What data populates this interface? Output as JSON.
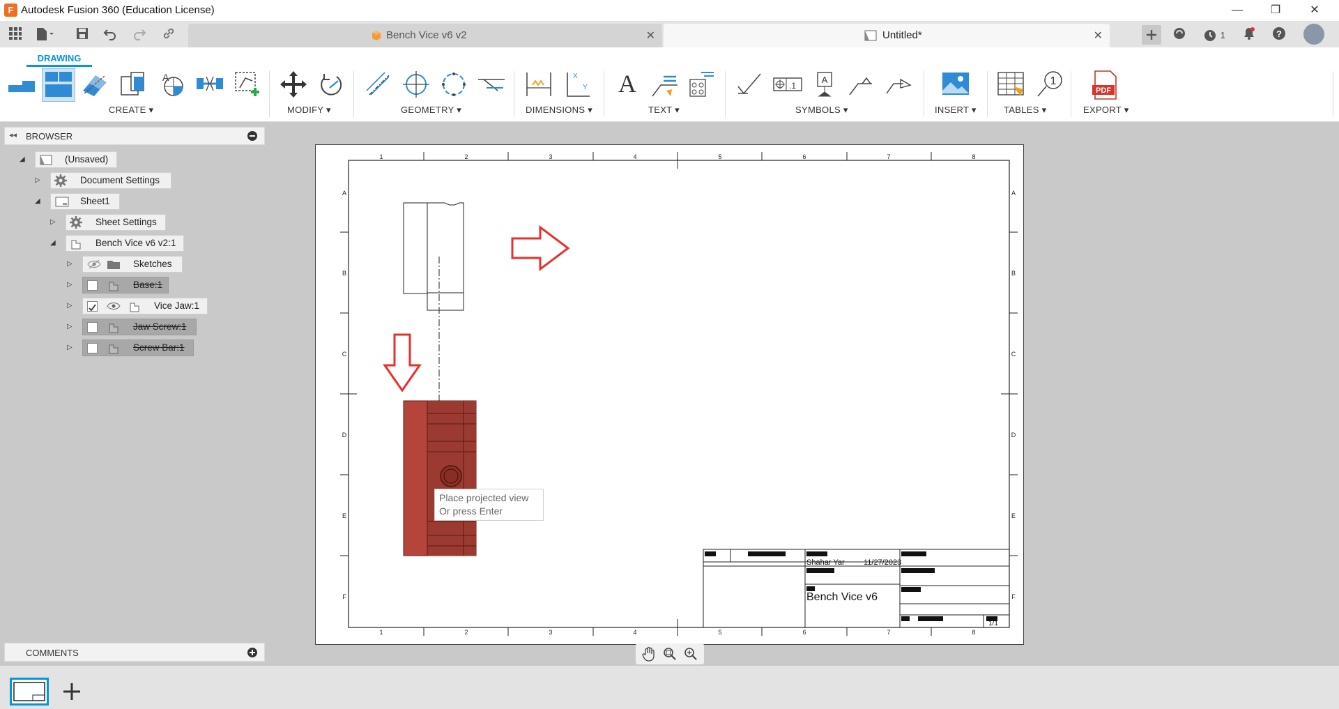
{
  "app": {
    "title": "Autodesk Fusion 360 (Education License)",
    "logo_letter": "F"
  },
  "window_controls": {
    "minimize": "—",
    "restore": "❐",
    "close": "✕"
  },
  "tabs": [
    {
      "label": "Bench Vice v6 v2",
      "active": false
    },
    {
      "label": "Untitled*",
      "active": true
    }
  ],
  "tabbar_right": {
    "jobs_count": "1"
  },
  "toolbar": {
    "workspace_tab": "DRAWING",
    "groups": [
      {
        "label": "CREATE ▾"
      },
      {
        "label": "MODIFY ▾"
      },
      {
        "label": "GEOMETRY ▾"
      },
      {
        "label": "DIMENSIONS ▾"
      },
      {
        "label": "TEXT ▾"
      },
      {
        "label": "SYMBOLS ▾"
      },
      {
        "label": "INSERT ▾"
      },
      {
        "label": "TABLES ▾"
      },
      {
        "label": "EXPORT ▾"
      }
    ],
    "text_tool_glyph": "A",
    "pdf_label": "PDF",
    "balloon_number": "1"
  },
  "browser": {
    "title": "BROWSER",
    "items": [
      {
        "label": "(Unsaved)"
      },
      {
        "label": "Document Settings"
      },
      {
        "label": "Sheet1"
      },
      {
        "label": "Sheet Settings"
      },
      {
        "label": "Bench Vice v6 v2:1"
      },
      {
        "label": "Sketches"
      },
      {
        "label": "Base:1",
        "visible": false
      },
      {
        "label": "Vice Jaw:1",
        "visible": true
      },
      {
        "label": "Jaw Screw:1",
        "visible": false
      },
      {
        "label": "Screw Bar:1",
        "visible": false
      }
    ]
  },
  "comments": {
    "title": "COMMENTS"
  },
  "sheet": {
    "col_labels": [
      "1",
      "2",
      "3",
      "4",
      "5",
      "6",
      "7",
      "8"
    ],
    "row_labels": [
      "A",
      "B",
      "C",
      "D",
      "E",
      "F"
    ],
    "title_block": {
      "author": "Shahar Yar",
      "date": "11/27/2023",
      "title": "Bench Vice v6",
      "sheet": "1/1"
    }
  },
  "tooltip": {
    "line1": "Place projected view",
    "line2": "Or press Enter"
  },
  "colors": {
    "accent": "#0696d7",
    "arrow": "#e8302b",
    "vice_jaw_fill": "#b5443a"
  }
}
